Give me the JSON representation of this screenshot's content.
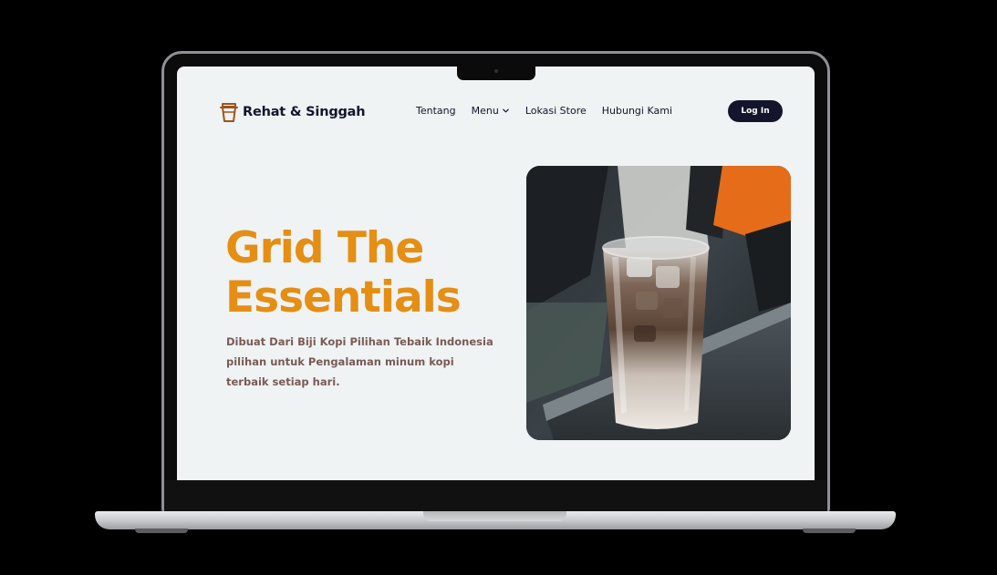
{
  "brand": {
    "name": "Rehat & Singgah",
    "icon": "coffee-cup-icon"
  },
  "nav": {
    "items": [
      {
        "label": "Tentang"
      },
      {
        "label": "Menu",
        "icon": "chevron-down-icon"
      },
      {
        "label": "Lokasi Store"
      },
      {
        "label": "Hubungi Kami"
      }
    ],
    "login_label": "Log In"
  },
  "hero": {
    "title_line1": "Grid The",
    "title_line2": "Essentials",
    "subtitle": "Dibuat Dari Biji Kopi Pilihan Tebaik Indonesia pilihan untuk Pengalaman minum kopi terbaik setiap hari.",
    "image": "iced-coffee-photo"
  },
  "colors": {
    "accent": "#e58e14",
    "navy": "#12152c",
    "page_bg": "#eff3f4",
    "subtitle": "#7a5a55"
  }
}
